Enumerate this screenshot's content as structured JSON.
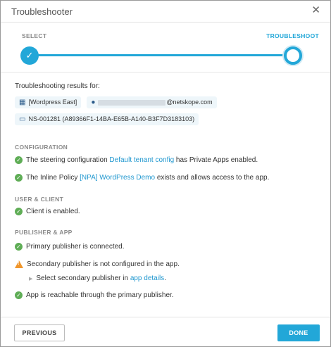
{
  "dialog": {
    "title": "Troubleshooter",
    "close_icon": "close-icon"
  },
  "stepper": {
    "steps": [
      {
        "label": "SELECT",
        "state": "done"
      },
      {
        "label": "TROUBLESHOOT",
        "state": "current"
      }
    ],
    "accent": "#22a7d8"
  },
  "results": {
    "title": "Troubleshooting results for:",
    "app": "[Wordpress East]",
    "user_domain": "@netskope.com",
    "device": "NS-001281 (A89366F1-14BA-E65B-A140-B3F7D3183103)"
  },
  "sections": {
    "configuration": {
      "heading": "CONFIGURATION",
      "line1": {
        "pre": "The steering configuration ",
        "link": "Default tenant config",
        "post": " has Private Apps enabled."
      },
      "line2": {
        "pre": "The Inline Policy ",
        "link": "[NPA] WordPress Demo",
        "post": " exists and allows access to the app."
      }
    },
    "user_client": {
      "heading": "USER & CLIENT",
      "line1": "Client is enabled."
    },
    "publisher_app": {
      "heading": "PUBLISHER & APP",
      "line1": "Primary publisher is connected.",
      "line2": "Secondary publisher is not configured in the app.",
      "sub": {
        "pre": "Select secondary publisher in ",
        "link": "app details",
        "post": "."
      },
      "line3": "App is reachable through the primary publisher."
    }
  },
  "footer": {
    "previous": "PREVIOUS",
    "done": "DONE"
  },
  "colors": {
    "ok": "#5fad56",
    "warn": "#f0962b",
    "link": "#1f97cf"
  }
}
